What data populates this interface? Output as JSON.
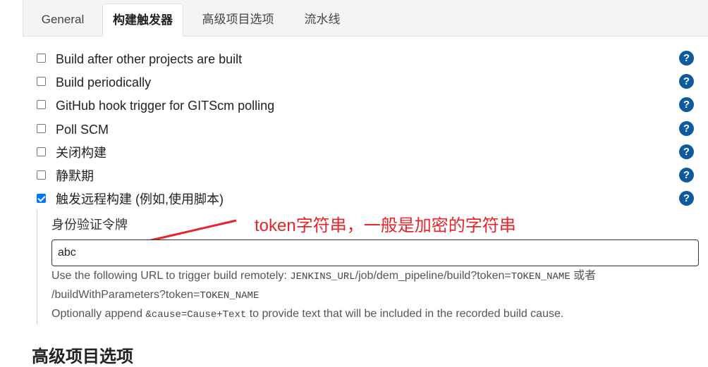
{
  "tabs": [
    {
      "label": "General",
      "active": false
    },
    {
      "label": "构建触发器",
      "active": true
    },
    {
      "label": "高级项目选项",
      "active": false
    },
    {
      "label": "流水线",
      "active": false
    }
  ],
  "triggers": [
    {
      "label": "Build after other projects are built",
      "checked": false
    },
    {
      "label": "Build periodically",
      "checked": false
    },
    {
      "label": "GitHub hook trigger for GITScm polling",
      "checked": false
    },
    {
      "label": "Poll SCM",
      "checked": false
    },
    {
      "label": "关闭构建",
      "checked": false
    },
    {
      "label": "静默期",
      "checked": false
    },
    {
      "label": "触发远程构建 (例如,使用脚本)",
      "checked": true
    }
  ],
  "help_glyph": "?",
  "remote": {
    "token_label": "身份验证令牌",
    "token_value": "abc",
    "annotation": "token字符串，一般是加密的字符串",
    "desc1_prefix": "Use the following URL to trigger build remotely: ",
    "desc1_code_a": "JENKINS_URL",
    "desc1_path": "/job/dem_pipeline/build?token=",
    "desc1_code_b": "TOKEN_NAME",
    "desc1_suffix": " 或者",
    "desc2_path": "/buildWithParameters?token=",
    "desc2_code": "TOKEN_NAME",
    "desc3_prefix": "Optionally append ",
    "desc3_code": "&cause=Cause+Text",
    "desc3_suffix": " to provide text that will be included in the recorded build cause."
  },
  "next_section_title": "高级项目选项",
  "colors": {
    "accent_blue": "#0e5a9e",
    "checkbox_blue": "#0075ff",
    "annotation_red": "#e8232a"
  }
}
